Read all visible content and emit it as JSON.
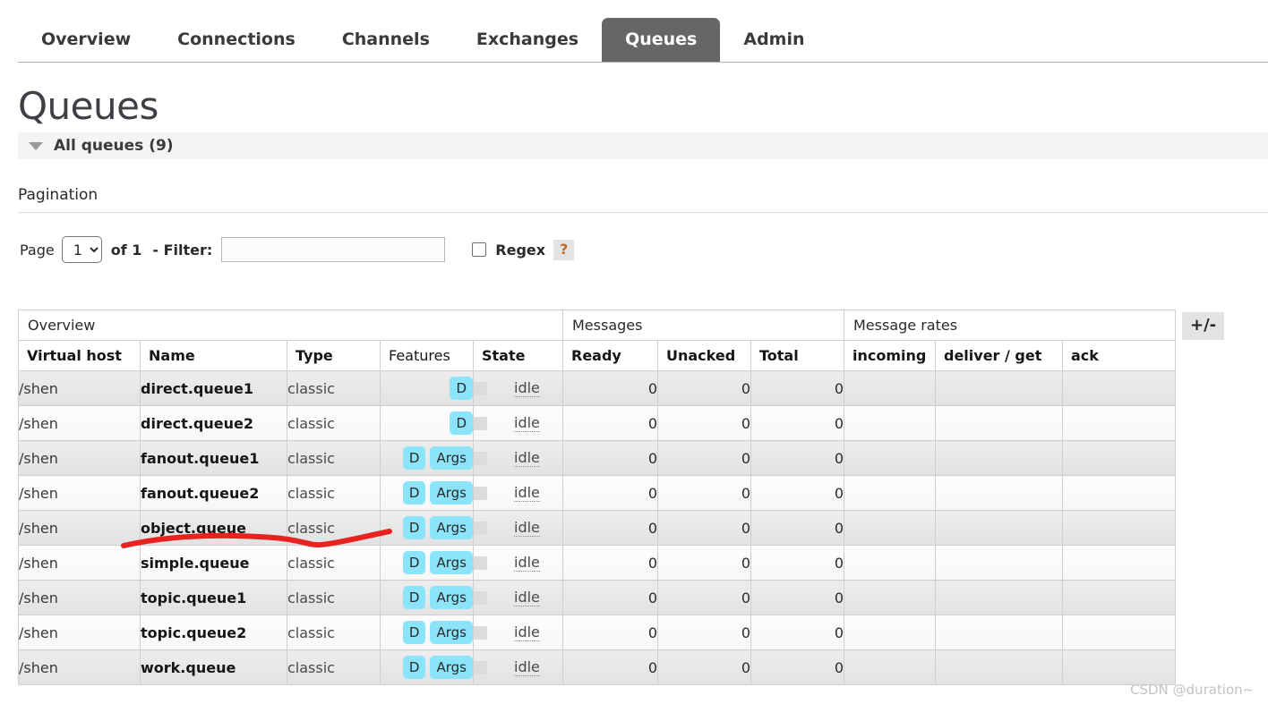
{
  "nav": {
    "items": [
      {
        "label": "Overview",
        "active": false
      },
      {
        "label": "Connections",
        "active": false
      },
      {
        "label": "Channels",
        "active": false
      },
      {
        "label": "Exchanges",
        "active": false
      },
      {
        "label": "Queues",
        "active": true
      },
      {
        "label": "Admin",
        "active": false
      }
    ]
  },
  "page": {
    "title": "Queues",
    "section_label": "All queues (9)",
    "collapse_icon": "triangle-down-icon"
  },
  "pagination": {
    "heading": "Pagination",
    "page_label": "Page",
    "page_value": "1",
    "page_options": [
      "1"
    ],
    "of_label": "of 1",
    "filter_label": "- Filter:",
    "filter_value": "",
    "filter_placeholder": "",
    "regex_label": "Regex",
    "regex_checked": false,
    "help_label": "?"
  },
  "table": {
    "group_headers": [
      {
        "label": "Overview",
        "span": 5
      },
      {
        "label": "Messages",
        "span": 3
      },
      {
        "label": "Message rates",
        "span": 3
      }
    ],
    "columns": [
      {
        "label": "Virtual host",
        "style": "sortable"
      },
      {
        "label": "Name",
        "style": "sortable"
      },
      {
        "label": "Type",
        "style": "sortable"
      },
      {
        "label": "Features",
        "style": "plain"
      },
      {
        "label": "State",
        "style": "sortable"
      },
      {
        "label": "Ready",
        "style": "numeric"
      },
      {
        "label": "Unacked",
        "style": "numeric"
      },
      {
        "label": "Total",
        "style": "numeric"
      },
      {
        "label": "incoming",
        "style": "numeric"
      },
      {
        "label": "deliver / get",
        "style": "numeric"
      },
      {
        "label": "ack",
        "style": "numeric"
      }
    ],
    "toggle_columns_label": "+/-",
    "rows": [
      {
        "vhost": "/shen",
        "name": "direct.queue1",
        "type": "classic",
        "features": [
          "D"
        ],
        "state": "idle",
        "ready": "0",
        "unacked": "0",
        "total": "0",
        "incoming": "",
        "deliver_get": "",
        "ack": ""
      },
      {
        "vhost": "/shen",
        "name": "direct.queue2",
        "type": "classic",
        "features": [
          "D"
        ],
        "state": "idle",
        "ready": "0",
        "unacked": "0",
        "total": "0",
        "incoming": "",
        "deliver_get": "",
        "ack": ""
      },
      {
        "vhost": "/shen",
        "name": "fanout.queue1",
        "type": "classic",
        "features": [
          "D",
          "Args"
        ],
        "state": "idle",
        "ready": "0",
        "unacked": "0",
        "total": "0",
        "incoming": "",
        "deliver_get": "",
        "ack": ""
      },
      {
        "vhost": "/shen",
        "name": "fanout.queue2",
        "type": "classic",
        "features": [
          "D",
          "Args"
        ],
        "state": "idle",
        "ready": "0",
        "unacked": "0",
        "total": "0",
        "incoming": "",
        "deliver_get": "",
        "ack": ""
      },
      {
        "vhost": "/shen",
        "name": "object.queue",
        "type": "classic",
        "features": [
          "D",
          "Args"
        ],
        "state": "idle",
        "ready": "0",
        "unacked": "0",
        "total": "0",
        "incoming": "",
        "deliver_get": "",
        "ack": ""
      },
      {
        "vhost": "/shen",
        "name": "simple.queue",
        "type": "classic",
        "features": [
          "D",
          "Args"
        ],
        "state": "idle",
        "ready": "0",
        "unacked": "0",
        "total": "0",
        "incoming": "",
        "deliver_get": "",
        "ack": ""
      },
      {
        "vhost": "/shen",
        "name": "topic.queue1",
        "type": "classic",
        "features": [
          "D",
          "Args"
        ],
        "state": "idle",
        "ready": "0",
        "unacked": "0",
        "total": "0",
        "incoming": "",
        "deliver_get": "",
        "ack": ""
      },
      {
        "vhost": "/shen",
        "name": "topic.queue2",
        "type": "classic",
        "features": [
          "D",
          "Args"
        ],
        "state": "idle",
        "ready": "0",
        "unacked": "0",
        "total": "0",
        "incoming": "",
        "deliver_get": "",
        "ack": ""
      },
      {
        "vhost": "/shen",
        "name": "work.queue",
        "type": "classic",
        "features": [
          "D",
          "Args"
        ],
        "state": "idle",
        "ready": "0",
        "unacked": "0",
        "total": "0",
        "incoming": "",
        "deliver_get": "",
        "ack": ""
      }
    ]
  },
  "annotation": {
    "type": "hand-drawn-underline",
    "color": "#e8231f",
    "target_row": "object.queue"
  },
  "watermark": {
    "text": "CSDN @duration~"
  },
  "colors": {
    "active_tab_bg": "#666666",
    "badge_bg": "#8ce4fb",
    "row_odd_bg": "#e8e8e8",
    "row_even_bg": "#fbfbfb",
    "help_text": "#c26a24",
    "annotation_red": "#e8231f"
  }
}
